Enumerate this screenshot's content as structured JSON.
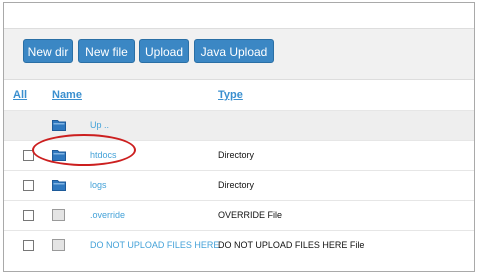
{
  "toolbar": {
    "new_dir": "New dir",
    "new_file": "New file",
    "upload": "Upload",
    "java_upload": "Java Upload"
  },
  "headers": {
    "all": "All",
    "name": "Name",
    "type": "Type"
  },
  "up_label": "Up ..",
  "rows": [
    {
      "name": "htdocs",
      "type": "Directory",
      "icon": "folder-icon"
    },
    {
      "name": "logs",
      "type": "Directory",
      "icon": "folder-icon"
    },
    {
      "name": ".override",
      "type": "OVERRIDE File",
      "icon": "file-icon"
    },
    {
      "name": "DO NOT UPLOAD FILES HERE",
      "type": "DO NOT UPLOAD FILES HERE File",
      "icon": "file-icon"
    }
  ],
  "colors": {
    "button_bg": "#3b87c4",
    "link": "#3a8fcf",
    "highlight": "#cc1f1f"
  }
}
